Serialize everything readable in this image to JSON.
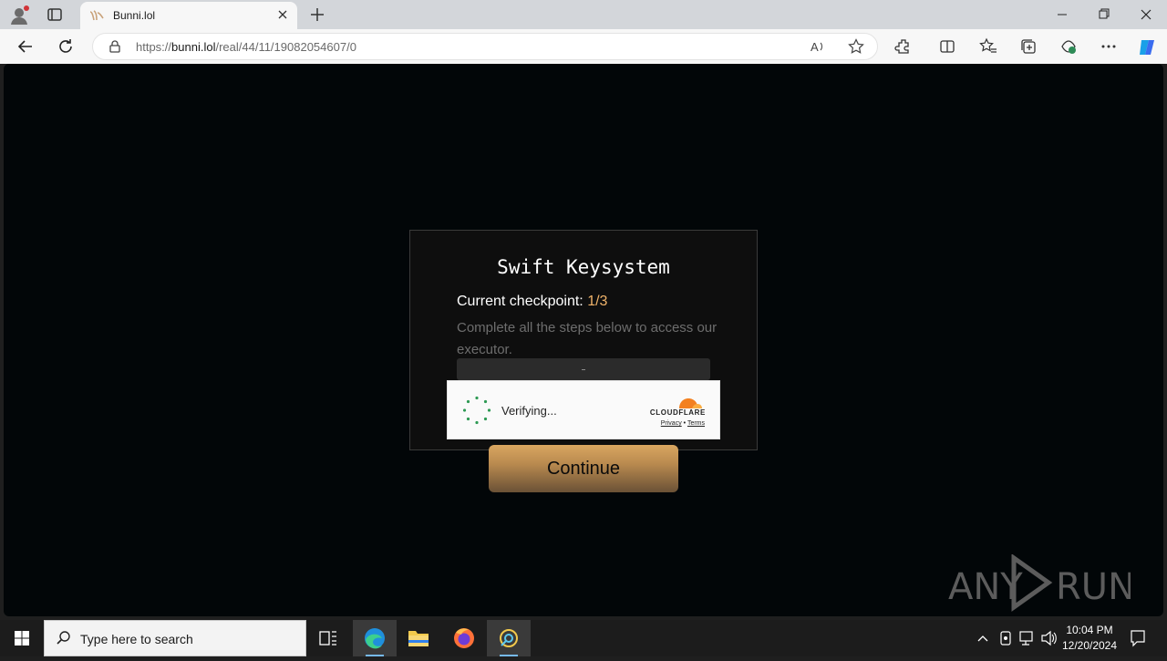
{
  "browser": {
    "tab_title": "Bunni.lol",
    "url_prefix": "https://",
    "url_host": "bunni.lol",
    "url_path": "/real/44/11/19082054607/0"
  },
  "card": {
    "title": "Swift Keysystem",
    "checkpoint_label": "Current checkpoint:",
    "checkpoint_value": "1/3",
    "description": "Complete all the steps below to access our executor."
  },
  "turnstile": {
    "status": "Verifying...",
    "brand": "CLOUDFLARE",
    "privacy": "Privacy",
    "separator": "•",
    "terms": "Terms"
  },
  "continue_label": "Continue",
  "watermark": "ANY RUN",
  "taskbar": {
    "search_placeholder": "Type here to search",
    "time": "10:04 PM",
    "date": "12/20/2024"
  },
  "colors": {
    "accent": "#f0b36a",
    "page_bg": "#020608",
    "button_gradient_top": "#d9a660",
    "cloudflare_orange": "#f38020"
  }
}
